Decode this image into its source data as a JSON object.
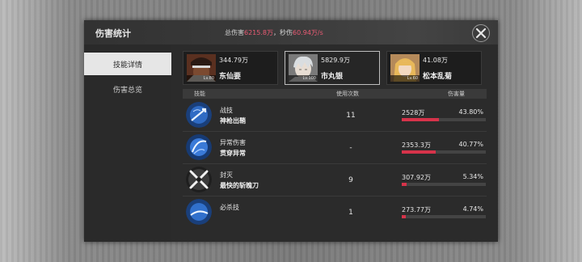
{
  "window": {
    "title": "伤害统计",
    "total_label": "总伤害",
    "total_value": "6215.8万",
    "separator": "，",
    "dps_label": "秒伤",
    "dps_value": "60.94万/s"
  },
  "sidebar": {
    "tabs": [
      {
        "label": "技能详情",
        "active": true
      },
      {
        "label": "伤害总览",
        "active": false
      }
    ]
  },
  "characters": [
    {
      "name": "东仙要",
      "damage": "344.79万",
      "level": "Lv.80",
      "selected": false
    },
    {
      "name": "市丸银",
      "damage": "5829.9万",
      "level": "Lv.100",
      "selected": true
    },
    {
      "name": "松本乱菊",
      "damage": "41.08万",
      "level": "Lv.60",
      "selected": false
    }
  ],
  "table": {
    "headers": {
      "skill": "技能",
      "uses": "使用次数",
      "damage": "伤害量"
    },
    "rows": [
      {
        "type": "战技",
        "name": "神枪出鞘",
        "uses": "11",
        "damage": "2528万",
        "percent": "43.80%",
        "fraction": 0.438,
        "icon": "spear-thrust-icon"
      },
      {
        "type": "异常伤害",
        "name": "贯穿异常",
        "uses": "-",
        "damage": "2353.3万",
        "percent": "40.77%",
        "fraction": 0.4077,
        "icon": "pierce-status-icon"
      },
      {
        "type": "封灭",
        "name": "最快的斩魄刀",
        "uses": "9",
        "damage": "307.92万",
        "percent": "5.34%",
        "fraction": 0.0534,
        "icon": "crossed-blades-icon"
      },
      {
        "type": "必杀技",
        "name": "",
        "uses": "1",
        "damage": "273.77万",
        "percent": "4.74%",
        "fraction": 0.0474,
        "icon": "ultimate-slash-icon"
      }
    ]
  },
  "colors": {
    "accent": "#ea5b74",
    "bar": "#d6334a"
  }
}
